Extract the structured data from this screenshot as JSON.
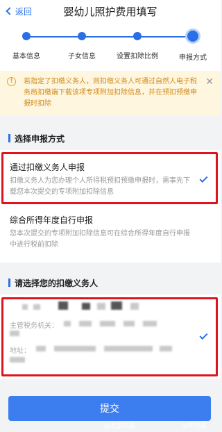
{
  "header": {
    "back_label": "返回",
    "title": "婴幼儿照护费用填写"
  },
  "steps": [
    {
      "label": "基本信息"
    },
    {
      "label": "子女信息"
    },
    {
      "label": "设置扣除比例"
    },
    {
      "label": "申报方式"
    }
  ],
  "notice": {
    "text": "若指定了扣缴义务人，则扣缴义务人可通过自然人电子税务局扣缴端下载该项专项附加扣除信息，并在预扣预缴申报时扣除"
  },
  "method_section": {
    "heading": "选择申报方式",
    "options": [
      {
        "title": "通过扣缴义务人申报",
        "desc": "扣缴义务人为您办理个人所得税预扣预缴申报时，需事先下载您本次提交的专项附加扣除信息",
        "selected": true
      },
      {
        "title": "综合所得年度自行申报",
        "desc": "您本次提交的专项附加扣除信息可在综合所得年度自行申报中进行税前扣除",
        "selected": false
      }
    ]
  },
  "agent_section": {
    "heading": "请选择您的扣缴义务人",
    "tax_office_label": "主管税务机关：",
    "address_label": "地址：",
    "selected": true
  },
  "submit_label": "提交",
  "watermarks": [
    "@北京日报",
    "@新京报"
  ],
  "colors": {
    "accent": "#2b6fe6",
    "highlight_border": "#e0141e",
    "notice_bg": "#fff6df",
    "notice_text": "#d08a19"
  }
}
